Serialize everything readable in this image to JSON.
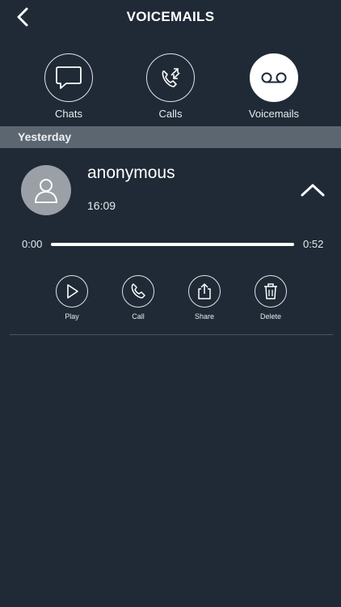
{
  "header": {
    "title": "VOICEMAILS"
  },
  "tabs": [
    {
      "label": "Chats",
      "icon": "chat-bubble-icon",
      "active": false
    },
    {
      "label": "Calls",
      "icon": "phone-arrows-icon",
      "active": false
    },
    {
      "label": "Voicemails",
      "icon": "voicemail-icon",
      "active": true
    }
  ],
  "section": {
    "title": "Yesterday"
  },
  "voicemail": {
    "caller": "anonymous",
    "time": "16:09",
    "position": "0:00",
    "duration": "0:52",
    "progress_fraction": 1.0
  },
  "actions": [
    {
      "label": "Play",
      "icon": "play-icon"
    },
    {
      "label": "Call",
      "icon": "phone-icon"
    },
    {
      "label": "Share",
      "icon": "share-icon"
    },
    {
      "label": "Delete",
      "icon": "trash-icon"
    }
  ],
  "colors": {
    "background": "#1f2a36",
    "section_header": "#5c6670",
    "foreground": "#ffffff",
    "avatar": "#9aa0a6"
  }
}
